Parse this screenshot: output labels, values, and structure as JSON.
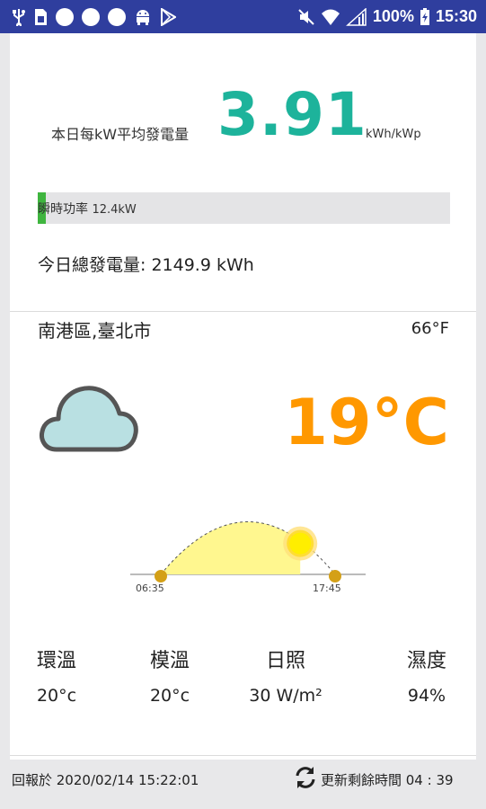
{
  "status_bar": {
    "icons": [
      "usb-icon",
      "sim-icon",
      "notification-dot-icon",
      "notification-dot-icon",
      "notification-dot-icon",
      "android-icon",
      "play-store-icon",
      "mute-icon",
      "wifi-icon",
      "signal-icon",
      "battery-icon"
    ],
    "battery": "100%",
    "time": "15:30"
  },
  "solar": {
    "avg_label": "本日每kW平均發電量",
    "avg_value": "3.91",
    "avg_unit": "kWh/kWp",
    "power_label": "瞬時功率",
    "power_value": "12.4kW",
    "power_fraction": 0.02,
    "total_label": "今日總發電量: 2149.9 kWh"
  },
  "weather": {
    "location": "南港區,臺北市",
    "temp_f": "66°F",
    "temp_c": "19°C",
    "condition_icon": "cloud-icon",
    "sunrise": "06:35",
    "sunset": "17:45",
    "day_progress": 0.8,
    "metrics": [
      {
        "label": "環溫",
        "value": "20°c"
      },
      {
        "label": "模溫",
        "value": "20°c"
      },
      {
        "label": "日照",
        "value": "30 W/m²"
      },
      {
        "label": "濕度",
        "value": "94%"
      }
    ]
  },
  "footer": {
    "report_time": "回報於 2020/02/14 15:22:01",
    "refresh_label": "更新剩餘時間 04 : 39"
  },
  "colors": {
    "status_bar": "#2f3e9e",
    "accent_green": "#1db39b",
    "bar_green": "#3fb53f",
    "temp_orange": "#ff9800",
    "sun_fill": "#fff78f"
  }
}
